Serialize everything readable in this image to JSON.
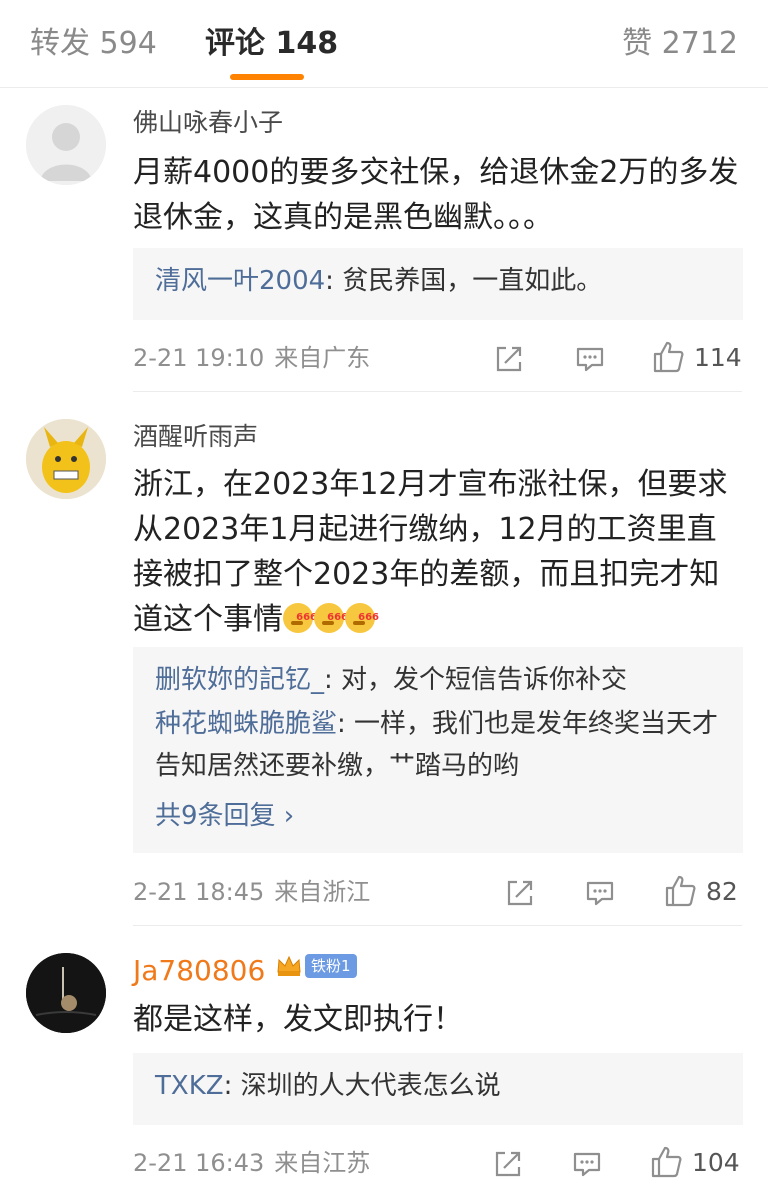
{
  "tabs": {
    "repost": "转发 594",
    "comments": "评论 148",
    "likes": "赞 2712",
    "accent": "#ff8200"
  },
  "comments": [
    {
      "user": "佛山咏春小子",
      "text": "月薪4000的要多交社保，给退休金2万的多发退休金，这真的是黑色幽默。。。",
      "replies": [
        {
          "name": "清风一叶2004",
          "text": ": 贫民养国，一直如此。"
        }
      ],
      "time": "2-21 19:10",
      "location": "来自广东",
      "likes": "114"
    },
    {
      "user": "酒醒听雨声",
      "text": "浙江，在2023年12月才宣布涨社保，但要求从2023年1月起进行缴纳，12月的工资里直接被扣了整个2023年的差额，而且扣完才知道这个事情",
      "emoji_tag": "666",
      "replies": [
        {
          "name": "删软妳的記钇_",
          "text": ": 对，发个短信告诉你补交"
        },
        {
          "name": "种花蜘蛛脆脆鲨",
          "text": ": 一样，我们也是发年终奖当天才告知居然还要补缴，艹踏马的哟"
        }
      ],
      "more_replies": "共9条回复 ›",
      "time": "2-21 18:45",
      "location": "来自浙江",
      "likes": "82"
    },
    {
      "user": "Ja780806",
      "badge": "铁粉1",
      "text": "都是这样，发文即执行！",
      "replies": [
        {
          "name": "TXKZ",
          "text": ": 深圳的人大代表怎么说"
        }
      ],
      "time": "2-21 16:43",
      "location": "来自江苏",
      "likes": "104"
    }
  ]
}
